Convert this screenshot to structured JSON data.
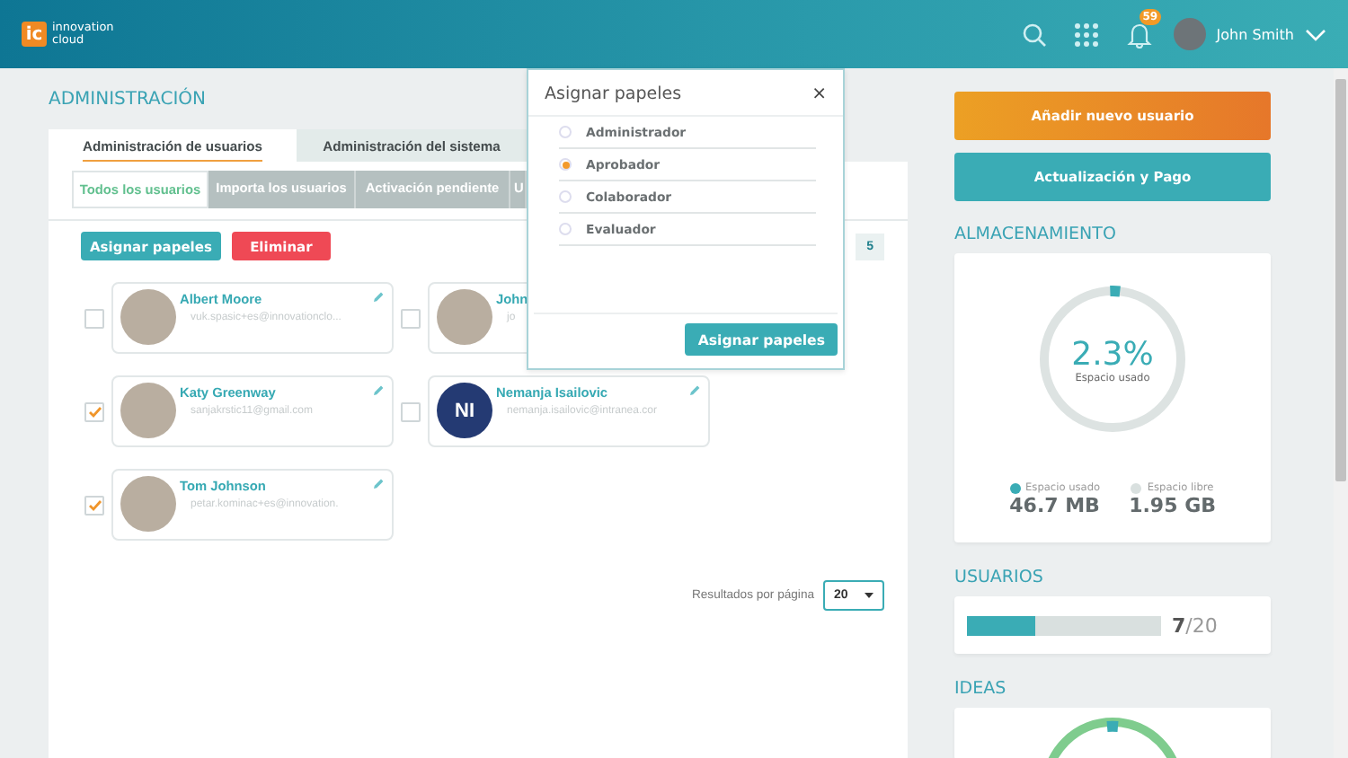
{
  "header": {
    "logo_mark": "ic",
    "logo_line1": "innovation",
    "logo_line2": "cloud",
    "notification_count": "59",
    "user_name": "John Smith"
  },
  "page_title": "ADMINISTRACIÓN",
  "main_tabs": [
    {
      "label": "Administración de usuarios",
      "selected": true
    },
    {
      "label": "Administración del sistema",
      "selected": false
    }
  ],
  "sub_tabs": [
    {
      "label": "Todos los usuarios",
      "selected": true
    },
    {
      "label": "Importa los usuarios",
      "selected": false
    },
    {
      "label": "Activación pendiente",
      "selected": false
    },
    {
      "label": "U",
      "selected": false
    }
  ],
  "actions": [
    {
      "label": "Asignar papeles",
      "kind": "primary"
    },
    {
      "label": "Eliminar",
      "kind": "danger"
    }
  ],
  "count": "5",
  "users": [
    {
      "name": "Albert Moore",
      "email": "vuk.spasic+es@innovationclo...",
      "checked": false,
      "kind": "photo"
    },
    {
      "name": "John",
      "email": "jo",
      "checked": false,
      "kind": "photo"
    },
    {
      "name": "Katy Greenway",
      "email": "sanjakrstic11@gmail.com",
      "checked": true,
      "kind": "photo"
    },
    {
      "name": "Nemanja Isailovic",
      "email": "nemanja.isailovic@intranea.cor",
      "checked": false,
      "kind": "initials",
      "initials": "NI"
    },
    {
      "name": "Tom Johnson",
      "email": "petar.kominac+es@innovation.",
      "checked": true,
      "kind": "photo"
    }
  ],
  "pagination": {
    "label": "Resultados por página",
    "value": "20"
  },
  "dialog": {
    "title": "Asignar papeles",
    "close": "×",
    "button": "Asignar papeles",
    "roles": [
      {
        "label": "Administrador",
        "selected": false
      },
      {
        "label": "Aprobador",
        "selected": true
      },
      {
        "label": "Colaborador",
        "selected": false
      },
      {
        "label": "Evaluador",
        "selected": false
      }
    ]
  },
  "sidebar": {
    "buttons": [
      {
        "label": "Añadir nuevo usuario",
        "kind": "orange"
      },
      {
        "label": "Actualización y Pago",
        "kind": "teal"
      }
    ],
    "storage": {
      "title": "ALMACENAMIENTO",
      "level": 0.023,
      "percent": "2.3%",
      "caption": "Espacio usado",
      "legend": [
        {
          "label": "Espacio usado",
          "value": "46.7 MB",
          "color": "#3aacb5"
        },
        {
          "label": "Espacio libre",
          "value": "1.95 GB",
          "color": "#d9e0df"
        }
      ]
    },
    "users": {
      "title": "USUARIOS",
      "level": 0.35,
      "used": "7",
      "total": "/20"
    },
    "ideas": {
      "title": "IDEAS"
    }
  }
}
